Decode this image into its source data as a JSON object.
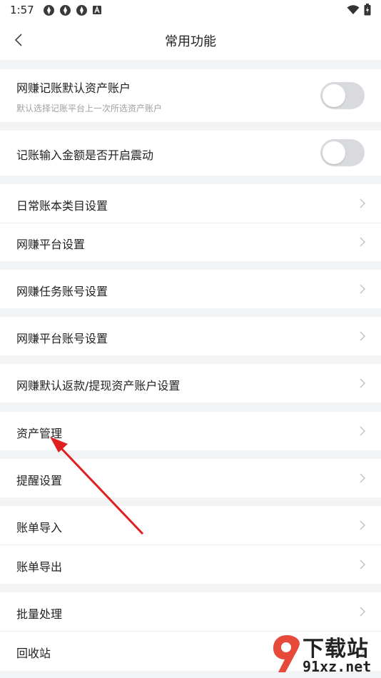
{
  "status_bar": {
    "time": "1:57"
  },
  "header": {
    "title": "常用功能"
  },
  "toggles": [
    {
      "label": "网赚记账默认资产账户",
      "sublabel": "默认选择记账平台上一次所选资产账户",
      "on": false
    },
    {
      "label": "记账输入金额是否开启震动",
      "on": false
    }
  ],
  "menu": [
    {
      "label": "日常账本类目设置"
    },
    {
      "label": "网赚平台设置"
    },
    {
      "label": "网赚任务账号设置"
    },
    {
      "label": "网赚平台账号设置"
    },
    {
      "label": "网赚默认返款/提现资产账户设置"
    },
    {
      "label": "资产管理"
    },
    {
      "label": "提醒设置"
    },
    {
      "label": "账单导入"
    },
    {
      "label": "账单导出"
    },
    {
      "label": "批量处理"
    },
    {
      "label": "回收站"
    }
  ],
  "watermark": {
    "main": "下载站",
    "url": "91xz.net"
  },
  "colors": {
    "annotation_arrow": "#e02020",
    "toggle_off": "#d8dade",
    "chevron": "#c4c4c8"
  }
}
